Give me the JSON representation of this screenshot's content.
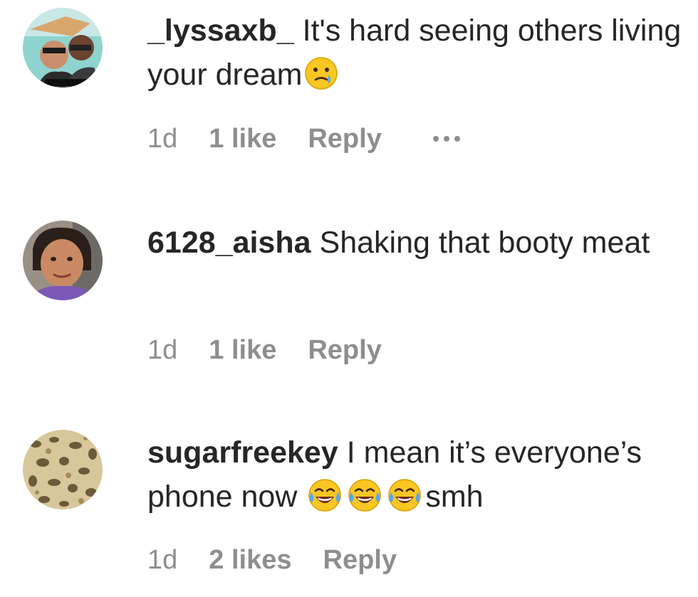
{
  "comments": [
    {
      "username": "_lyssaxb_",
      "text_before": "It's hard seeing others living your dream",
      "emojis": [
        "crying-face"
      ],
      "text_after": "",
      "time": "1d",
      "likes": "1 like",
      "reply": "Reply",
      "has_more_menu": true
    },
    {
      "username": "6128_aisha",
      "text_before": "Shaking that booty meat",
      "emojis": [],
      "text_after": "",
      "time": "1d",
      "likes": "1 like",
      "reply": "Reply",
      "has_more_menu": false
    },
    {
      "username": "sugarfreekey",
      "text_before": "I mean it’s everyone’s phone now ",
      "emojis": [
        "face-with-tears-of-joy",
        "face-with-tears-of-joy",
        "face-with-tears-of-joy"
      ],
      "text_after": "smh",
      "time": "1d",
      "likes": "2 likes",
      "reply": "Reply",
      "has_more_menu": false
    }
  ],
  "colors": {
    "text": "#262626",
    "muted": "#8e8e8e",
    "emoji_yellow": "#f9c623",
    "tear_blue": "#5aa8e6"
  }
}
